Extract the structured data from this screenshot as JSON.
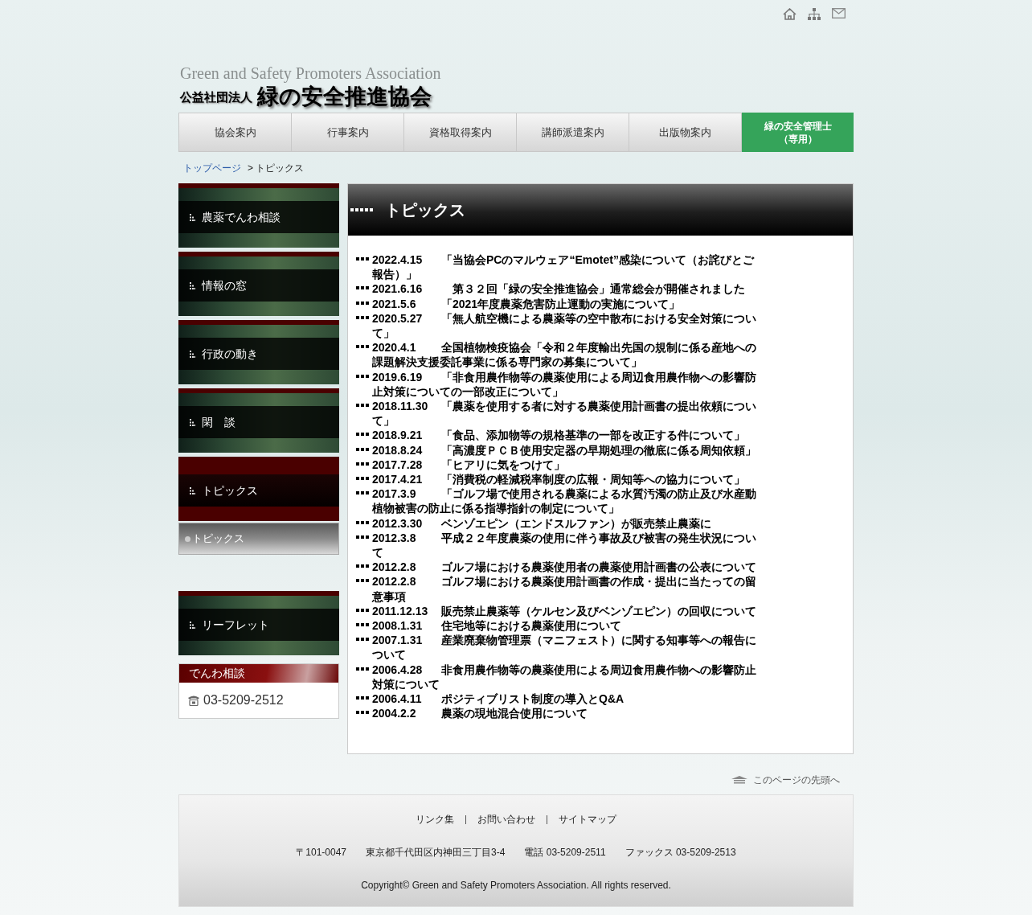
{
  "header": {
    "subtitle": "Green and Safety Promoters Association",
    "org_type": "公益社団法人",
    "org_name": "緑の安全推進協会"
  },
  "nav": [
    {
      "label": "協会案内",
      "kind": "normal"
    },
    {
      "label": "行事案内",
      "kind": "normal"
    },
    {
      "label": "資格取得案内",
      "kind": "normal"
    },
    {
      "label": "講師派遣案内",
      "kind": "normal"
    },
    {
      "label": "出版物案内",
      "kind": "normal"
    },
    {
      "lines": [
        "緑の安全管理士",
        "（専用）"
      ],
      "kind": "members"
    }
  ],
  "breadcrumb": {
    "home": "トップページ",
    "current": "> トピックス"
  },
  "sidebar": {
    "items": [
      {
        "label": "農薬でんわ相談",
        "selected": false
      },
      {
        "label": "情報の窓",
        "selected": false
      },
      {
        "label": "行政の動き",
        "selected": false
      },
      {
        "label": "閑　談",
        "selected": false
      },
      {
        "label": "トピックス",
        "selected": true
      }
    ],
    "subitems": [
      {
        "label": "トピックス"
      }
    ],
    "leaflet": {
      "label": "リーフレット",
      "selected": false
    },
    "phone_box": {
      "title": "でんわ相談",
      "number": "03-5209-2512"
    }
  },
  "content": {
    "title": "トピックス",
    "topics": [
      {
        "date": "2022.4.15",
        "title": "「当協会PCのマルウェア“Emotet”感染について（お詫びとご報告）」"
      },
      {
        "date": "2021.6.16",
        "title": "　第３２回「緑の安全推進協会」通常総会が開催されました"
      },
      {
        "date": "2021.5.6",
        "title": "「2021年度農薬危害防止運動の実施について」"
      },
      {
        "date": "2020.5.27",
        "title": "「無人航空機による農薬等の空中散布における安全対策について」"
      },
      {
        "date": "2020.4.1",
        "title": "全国植物検疫協会「令和２年度輸出先国の規制に係る産地への課題解決支援委託事業に係る専門家の募集について」"
      },
      {
        "date": "2019.6.19",
        "title": "「非食用農作物等の農薬使用による周辺食用農作物への影響防止対策についての一部改正について」"
      },
      {
        "date": "2018.11.30",
        "title": "「農薬を使用する者に対する農薬使用計画書の提出依頼について」"
      },
      {
        "date": "2018.9.21",
        "title": "「食品、添加物等の規格基準の一部を改正する件について」"
      },
      {
        "date": "2018.8.24",
        "title": "「高濃度ＰＣＢ使用安定器の早期処理の徹底に係る周知依頼」"
      },
      {
        "date": "2017.7.28",
        "title": "「ヒアリに気をつけて」"
      },
      {
        "date": "2017.4.21",
        "title": "「消費税の軽減税率制度の広報・周知等への協力について」"
      },
      {
        "date": "2017.3.9",
        "title": "「ゴルフ場で使用される農薬による水質汚濁の防止及び水産動植物被害の防止に係る指導指針の制定について」"
      },
      {
        "date": "2012.3.30",
        "title": "ベンゾエピン（エンドスルファン）が販売禁止農薬に"
      },
      {
        "date": "2012.3.8",
        "title": "平成２２年度農薬の使用に伴う事故及び被害の発生状況について"
      },
      {
        "date": "2012.2.8",
        "title": "ゴルフ場における農薬使用者の農薬使用計画書の公表について"
      },
      {
        "date": "2012.2.8",
        "title": "ゴルフ場における農薬使用計画書の作成・提出に当たっての留意事項"
      },
      {
        "date": "2011.12.13",
        "title": "販売禁止農薬等（ケルセン及びベンゾエピン）の回収について"
      },
      {
        "date": "2008.1.31",
        "title": "住宅地等における農薬使用について"
      },
      {
        "date": "2007.1.31",
        "title": "産業廃棄物管理票（マニフェスト）に関する知事等への報告について"
      },
      {
        "date": "2006.4.28",
        "title": "非食用農作物等の農薬使用による周辺食用農作物への影響防止対策について"
      },
      {
        "date": "2006.4.11",
        "title": "ポジティブリスト制度の導入とQ&A"
      },
      {
        "date": "2004.2.2",
        "title": "農薬の現地混合使用について"
      }
    ]
  },
  "page_top": "このページの先頭へ",
  "footer": {
    "links": [
      "リンク集",
      "お問い合わせ",
      "サイトマップ"
    ],
    "address": [
      "〒101-0047",
      "東京都千代田区内神田三丁目3-4",
      "電話 03-5209-2511",
      "ファックス 03-5209-2513"
    ],
    "copyright": "Copyright© Green and Safety Promoters Association. All rights reserved."
  }
}
